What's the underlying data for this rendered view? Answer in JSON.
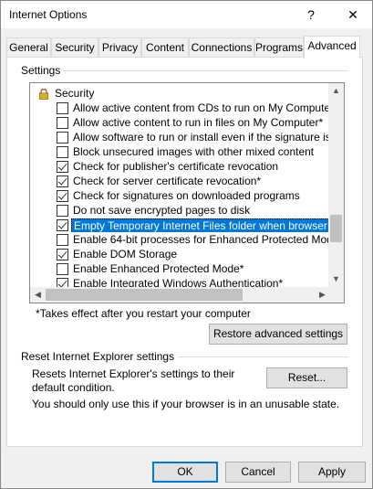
{
  "window": {
    "title": "Internet Options",
    "help_glyph": "?",
    "close_glyph": "✕"
  },
  "tabs": [
    {
      "label": "General"
    },
    {
      "label": "Security"
    },
    {
      "label": "Privacy"
    },
    {
      "label": "Content"
    },
    {
      "label": "Connections"
    },
    {
      "label": "Programs"
    },
    {
      "label": "Advanced",
      "active": true
    }
  ],
  "settings": {
    "group_label": "Settings",
    "category": "Security",
    "items": [
      {
        "label": "Allow active content from CDs to run on My Computer*",
        "checked": false
      },
      {
        "label": "Allow active content to run in files on My Computer*",
        "checked": false
      },
      {
        "label": "Allow software to run or install even if the signature is inva",
        "checked": false
      },
      {
        "label": "Block unsecured images with other mixed content",
        "checked": false
      },
      {
        "label": "Check for publisher's certificate revocation",
        "checked": true
      },
      {
        "label": "Check for server certificate revocation*",
        "checked": true
      },
      {
        "label": "Check for signatures on downloaded programs",
        "checked": true
      },
      {
        "label": "Do not save encrypted pages to disk",
        "checked": false
      },
      {
        "label": "Empty Temporary Internet Files folder when browser is clo",
        "checked": true,
        "selected": true
      },
      {
        "label": "Enable 64-bit processes for Enhanced Protected Mode*",
        "checked": false
      },
      {
        "label": "Enable DOM Storage",
        "checked": true
      },
      {
        "label": "Enable Enhanced Protected Mode*",
        "checked": false
      },
      {
        "label": "Enable Integrated Windows Authentication*",
        "checked": true
      }
    ],
    "note": "*Takes effect after you restart your computer",
    "restore_button": "Restore advanced settings"
  },
  "reset": {
    "group_label": "Reset Internet Explorer settings",
    "description": "Resets Internet Explorer's settings to their default condition.",
    "button": "Reset...",
    "hint": "You should only use this if your browser is in an unusable state."
  },
  "footer": {
    "ok": "OK",
    "cancel": "Cancel",
    "apply": "Apply"
  }
}
